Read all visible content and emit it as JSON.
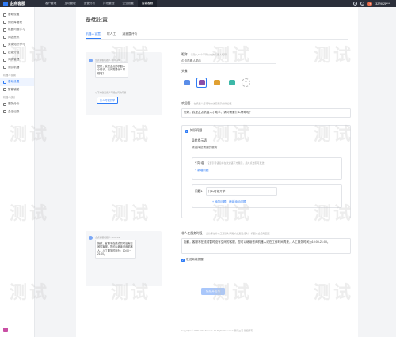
{
  "app": {
    "logo_text": "企点客服",
    "nav": [
      "客户管理",
      "互动管理",
      "运营分析",
      "排班管理",
      "企业设置",
      "智能客服"
    ],
    "nav_active_index": 5,
    "user_id": "3279028***",
    "avatar_text": "T"
  },
  "sidebar": {
    "items_top": [
      {
        "label": "基础设置",
        "icon": "settings-icon"
      },
      {
        "label": "知识库管理",
        "icon": "book-icon"
      },
      {
        "label": "机器问题学习",
        "icon": "learn-icon"
      },
      {
        "label": "问答资讯",
        "icon": "qa-icon"
      },
      {
        "label": "实体知识学习",
        "icon": "entity-icon"
      },
      {
        "label": "技能分组",
        "icon": "group-icon"
      },
      {
        "label": "词典管理",
        "icon": "dict-icon"
      },
      {
        "label": "测试机器",
        "icon": "test-icon"
      }
    ],
    "group1_label": "机器人设置",
    "items_mid": [
      {
        "label": "基础设置",
        "icon": "gear-icon",
        "active": true
      },
      {
        "label": "智能辅助",
        "icon": "assist-icon"
      }
    ],
    "group2_label": "机器人统计",
    "items_bottom": [
      {
        "label": "服务分析",
        "icon": "chart-icon"
      },
      {
        "label": "会话记录",
        "icon": "record-icon"
      }
    ]
  },
  "page": {
    "title": "基础设置",
    "tabs": [
      "机器人设置",
      "转人工",
      "满意度评价"
    ],
    "active_tab": 0
  },
  "preview1": {
    "meta": "企点客服机器人 10:06:23",
    "text": "您好，我是企点的机器人小助手，请问需要什么帮助呢？",
    "sep": "以下内容是客户可能会问的问题",
    "button": "什么时候开学"
  },
  "form": {
    "name_label": "昵称",
    "name_hint": "请输入10个字符以内的机器人昵称",
    "name_value": "企点机器人助手",
    "avatar_label": "头像",
    "welcome_label": "欢迎语",
    "welcome_hint": "在机器人接待时向访客展示的欢迎语",
    "welcome_value": "您好，我是企点机器人小助手，请问需要什么帮助呢？",
    "quick_tab": "知识问题",
    "knowledge_title": "导航提示语",
    "knowledge_value": "请选择您需要的服务",
    "faq_label": "引导语",
    "faq_hint": "设置引导语后将在欢迎语下方展示，用户点击即可发送",
    "faq_add": "+ 新增问题",
    "q_label": "问题1",
    "q_value": "什么时候开学",
    "q_add": "+ 添加问题，继续添加问题",
    "offline_label": "非人工服务时段",
    "offline_hint": "当访客在非人工服务时间段内发起会话时，机器人会自动回复",
    "offline_value": "抱歉，客服不在线或暂时没有空闲的客服，您可以继续咨询机器人或在工作时间再来，人工服务时间为10:00-21:00。",
    "checkbox_label": "发送离线提醒"
  },
  "preview2": {
    "meta": "企点客服机器人 10:06:23",
    "text": "抱歉，客服不在线或暂时没有空闲的客服，您可以继续咨询机器人，人工服务时间为：10:00－21:00。"
  },
  "save_label": "保存并发布",
  "footer": "Copyright © 1998-2024 Tencent. All Rights Reserved. 腾讯公司 版权所有",
  "watermark_text": "测试"
}
